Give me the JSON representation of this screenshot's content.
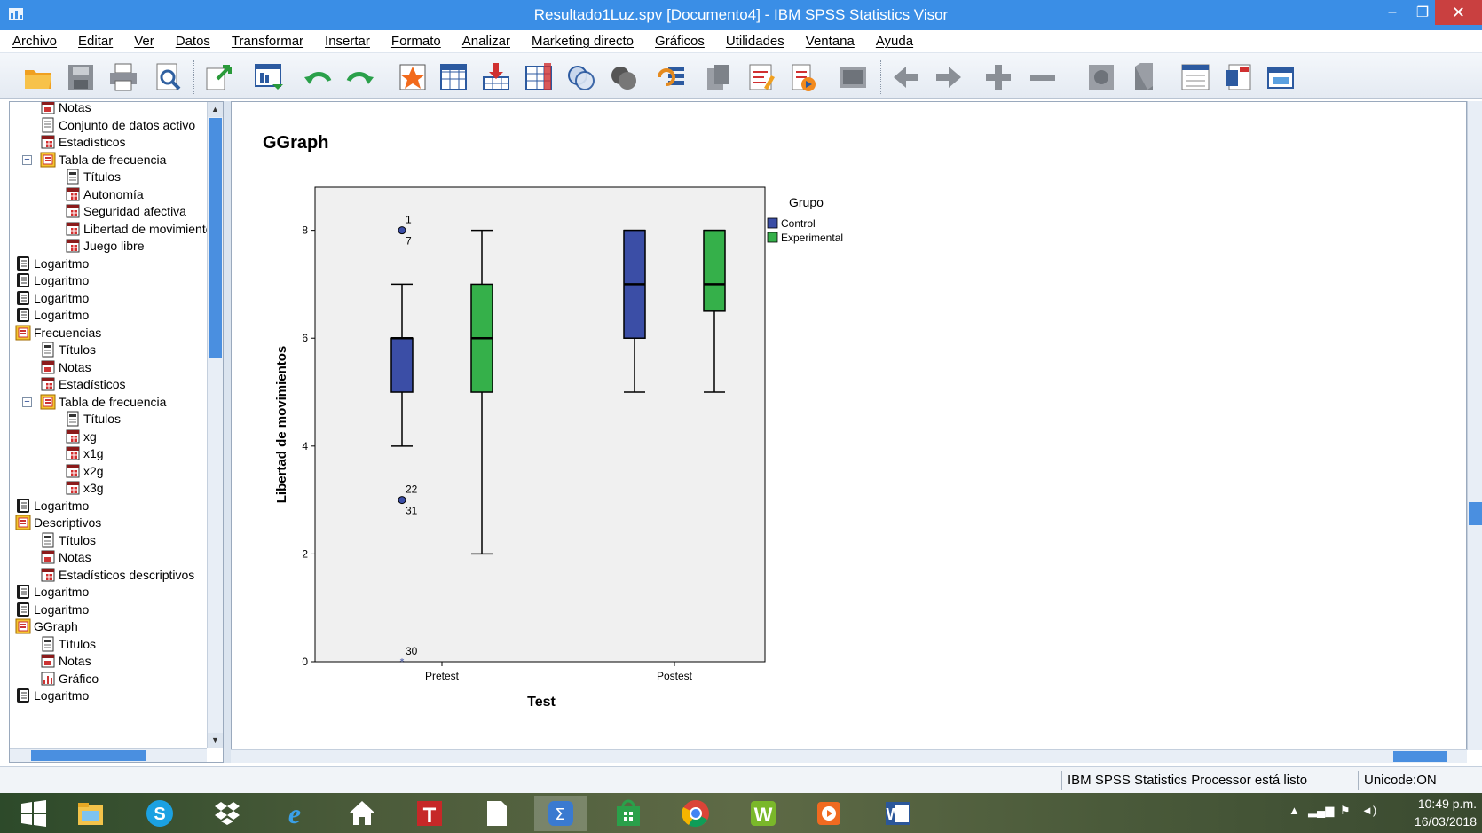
{
  "window": {
    "title": "Resultado1Luz.spv [Documento4] - IBM SPSS Statistics Visor",
    "min": "–",
    "max": "❐",
    "close": "✕"
  },
  "menu": [
    "Archivo",
    "Editar",
    "Ver",
    "Datos",
    "Transformar",
    "Insertar",
    "Formato",
    "Analizar",
    "Marketing directo",
    "Gráficos",
    "Utilidades",
    "Ventana",
    "Ayuda"
  ],
  "toolbar": {
    "icons": [
      "open-icon",
      "save-icon",
      "print-icon",
      "print-preview-icon",
      "export-icon",
      "recall-dialog-icon",
      "undo-icon",
      "redo-icon",
      "goto-data-icon",
      "goto-case-icon",
      "goto-variable-icon",
      "variables-icon",
      "use-sets-icon",
      "show-all-variables-icon",
      "spell-check-icon",
      "designate-window-icon",
      "show-hide-icon",
      "insert-heading-icon",
      "insert-title-icon",
      "insert-text-icon",
      "output-view-icon",
      "back-icon",
      "forward-icon",
      "expand-icon",
      "collapse-icon",
      "show-icon",
      "hide-icon",
      "insert-new-heading-icon",
      "insert-new-title-icon",
      "insert-new-text-icon"
    ]
  },
  "outline": {
    "items": [
      {
        "label": "Notas",
        "icon": "notes-icon",
        "level": 2
      },
      {
        "label": "Conjunto de datos activo",
        "icon": "dataset-icon",
        "level": 2
      },
      {
        "label": "Estadísticos",
        "icon": "table-icon",
        "level": 2
      },
      {
        "label": "Tabla de frecuencia",
        "icon": "folder-icon",
        "level": 2,
        "expander": "−"
      },
      {
        "label": "Títulos",
        "icon": "title-icon",
        "level": 3
      },
      {
        "label": "Autonomía",
        "icon": "table-icon",
        "level": 3
      },
      {
        "label": "Seguridad afectiva",
        "icon": "table-icon",
        "level": 3
      },
      {
        "label": "Libertad de movimientos",
        "icon": "table-icon",
        "level": 3
      },
      {
        "label": "Juego libre",
        "icon": "table-icon",
        "level": 3
      },
      {
        "label": "Logaritmo",
        "icon": "log-icon",
        "level": 1
      },
      {
        "label": "Logaritmo",
        "icon": "log-icon",
        "level": 1
      },
      {
        "label": "Logaritmo",
        "icon": "log-icon",
        "level": 1
      },
      {
        "label": "Logaritmo",
        "icon": "log-icon",
        "level": 1
      },
      {
        "label": "Frecuencias",
        "icon": "folder-icon",
        "level": 1
      },
      {
        "label": "Títulos",
        "icon": "title-icon",
        "level": 2
      },
      {
        "label": "Notas",
        "icon": "notes-icon",
        "level": 2
      },
      {
        "label": "Estadísticos",
        "icon": "table-icon",
        "level": 2
      },
      {
        "label": "Tabla de frecuencia",
        "icon": "folder-icon",
        "level": 2,
        "expander": "−"
      },
      {
        "label": "Títulos",
        "icon": "title-icon",
        "level": 3
      },
      {
        "label": "xg",
        "icon": "table-icon",
        "level": 3
      },
      {
        "label": "x1g",
        "icon": "table-icon",
        "level": 3
      },
      {
        "label": "x2g",
        "icon": "table-icon",
        "level": 3
      },
      {
        "label": "x3g",
        "icon": "table-icon",
        "level": 3
      },
      {
        "label": "Logaritmo",
        "icon": "log-icon",
        "level": 1
      },
      {
        "label": "Descriptivos",
        "icon": "folder-icon",
        "level": 1
      },
      {
        "label": "Títulos",
        "icon": "title-icon",
        "level": 2
      },
      {
        "label": "Notas",
        "icon": "notes-icon",
        "level": 2
      },
      {
        "label": "Estadísticos descriptivos",
        "icon": "table-icon",
        "level": 2
      },
      {
        "label": "Logaritmo",
        "icon": "log-icon",
        "level": 1
      },
      {
        "label": "Logaritmo",
        "icon": "log-icon",
        "level": 1
      },
      {
        "label": "GGraph",
        "icon": "folder-icon",
        "level": 1
      },
      {
        "label": "Títulos",
        "icon": "title-icon",
        "level": 2
      },
      {
        "label": "Notas",
        "icon": "notes-icon",
        "level": 2
      },
      {
        "label": "Gráfico",
        "icon": "chart-icon",
        "level": 2
      },
      {
        "label": "Logaritmo",
        "icon": "log-icon",
        "level": 1
      }
    ]
  },
  "content": {
    "heading": "GGraph"
  },
  "chart_data": {
    "type": "boxplot",
    "xlabel": "Test",
    "ylabel": "Libertad de movimientos",
    "categories": [
      "Pretest",
      "Postest"
    ],
    "ylim": [
      0,
      8.8
    ],
    "yticks": [
      0,
      2,
      4,
      6,
      8
    ],
    "legend": {
      "title": "Grupo",
      "position": "right"
    },
    "series": [
      {
        "name": "Control",
        "color": "#3b4ea6",
        "boxes": [
          {
            "category": "Pretest",
            "min": 4,
            "q1": 5,
            "median": 6,
            "q3": 6,
            "max": 7,
            "outliers": [
              {
                "value": 8,
                "labels": [
                  "1",
                  "7"
                ]
              },
              {
                "value": 3,
                "labels": [
                  "22",
                  "31"
                ]
              },
              {
                "value": 0,
                "labels": [
                  "30"
                ],
                "marker": "extreme"
              }
            ]
          },
          {
            "category": "Postest",
            "min": 5,
            "q1": 6,
            "median": 7,
            "q3": 8,
            "max": 8,
            "outliers": []
          }
        ]
      },
      {
        "name": "Experimental",
        "color": "#35b04a",
        "boxes": [
          {
            "category": "Pretest",
            "min": 2,
            "q1": 5,
            "median": 6,
            "q3": 7,
            "max": 8,
            "outliers": []
          },
          {
            "category": "Postest",
            "min": 5,
            "q1": 6.5,
            "median": 7,
            "q3": 8,
            "max": 8,
            "outliers": []
          }
        ]
      }
    ]
  },
  "statusbar": {
    "processor": "IBM SPSS Statistics Processor está listo",
    "unicode": "Unicode:ON"
  },
  "taskbar": {
    "apps": [
      "windows-start-icon",
      "file-explorer-icon",
      "skype-icon",
      "dropbox-icon",
      "internet-explorer-icon",
      "home-icon",
      "t-app-icon",
      "blank-document-icon",
      "spss-icon",
      "store-icon",
      "chrome-icon",
      "w-app-icon",
      "media-player-icon",
      "word-icon"
    ],
    "time": "10:49 p.m.",
    "date": "16/03/2018"
  }
}
